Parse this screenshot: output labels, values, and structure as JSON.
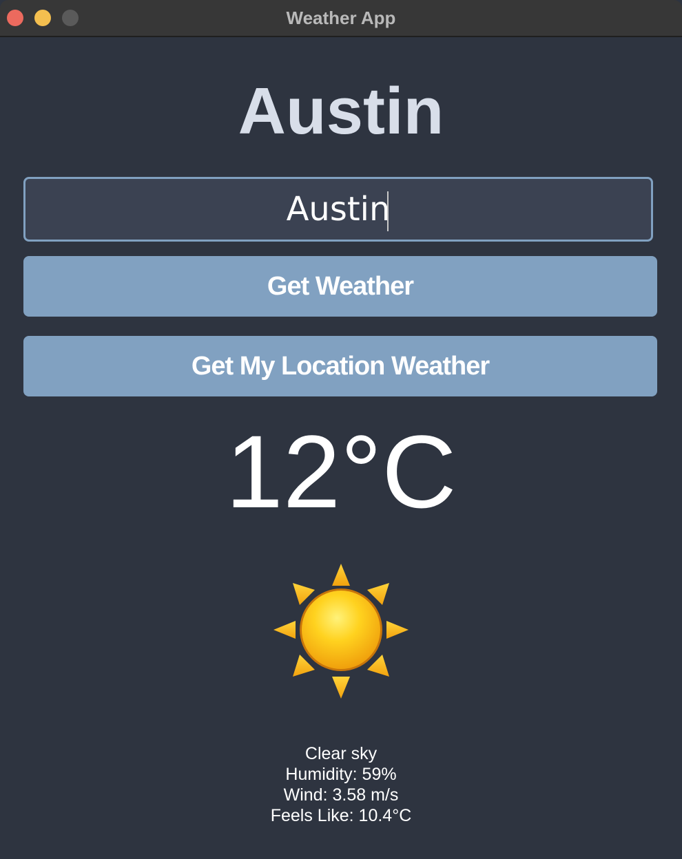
{
  "window": {
    "title": "Weather App"
  },
  "city_heading": "Austin",
  "search": {
    "value": "Austin"
  },
  "buttons": {
    "get_weather": "Get Weather",
    "get_location_weather": "Get My Location Weather"
  },
  "temperature": "12°C",
  "weather_icon": "sun-icon",
  "details": {
    "description": "Clear sky",
    "humidity": "Humidity: 59%",
    "wind": "Wind: 3.58 m/s",
    "feels_like": "Feels Like: 10.4°C"
  },
  "colors": {
    "background": "#2e3440",
    "input_background": "#3b4252",
    "accent": "#81a1c1",
    "heading": "#d8dee9"
  }
}
